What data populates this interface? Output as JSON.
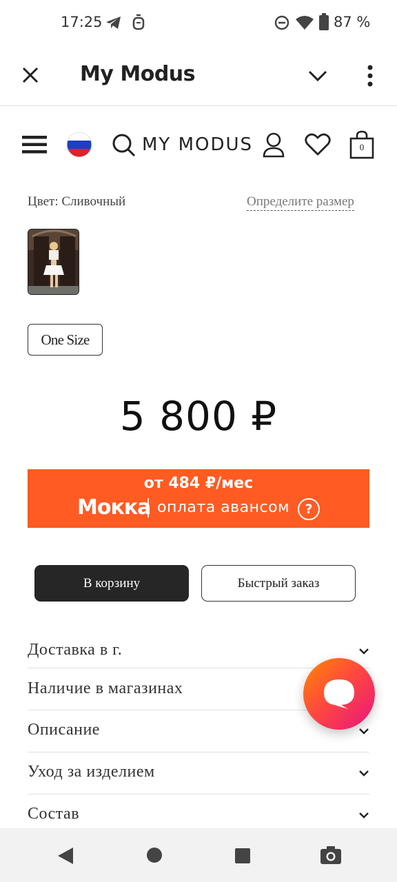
{
  "status_bar": {
    "time": "17:25",
    "battery": "87 %"
  },
  "app_bar": {
    "title": "My Modus"
  },
  "site_header": {
    "logo": "MY MODUS",
    "cart_count": "0"
  },
  "product": {
    "color_label": "Цвет: Сливочный",
    "size_guide_link": "Определите размер",
    "size_option": "One Size",
    "price": "5 800 ₽"
  },
  "mokka": {
    "installment": "от 484 ₽/мес",
    "brand": "Мокка",
    "text": "оплата авансом",
    "help": "?",
    "color": "#ff5b22"
  },
  "buttons": {
    "add_to_cart": "В корзину",
    "quick_order": "Быстрый заказ"
  },
  "accordion": [
    {
      "label": "Доставка в г."
    },
    {
      "label": "Наличие в магазинах"
    },
    {
      "label": "Описание"
    },
    {
      "label": "Уход за изделием"
    },
    {
      "label": "Состав"
    }
  ]
}
